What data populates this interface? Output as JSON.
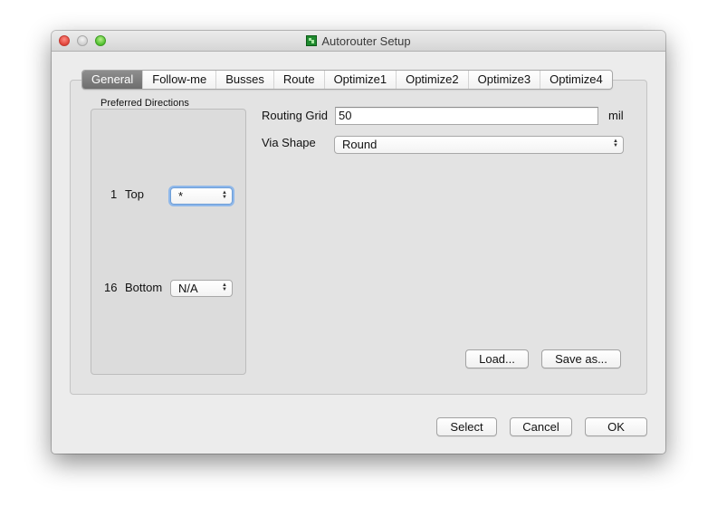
{
  "window": {
    "title": "Autorouter Setup",
    "app_icon": "eagle-app-icon"
  },
  "tabs": [
    {
      "label": "General",
      "active": true
    },
    {
      "label": "Follow-me",
      "active": false
    },
    {
      "label": "Busses",
      "active": false
    },
    {
      "label": "Route",
      "active": false
    },
    {
      "label": "Optimize1",
      "active": false
    },
    {
      "label": "Optimize2",
      "active": false
    },
    {
      "label": "Optimize3",
      "active": false
    },
    {
      "label": "Optimize4",
      "active": false
    }
  ],
  "preferred_directions": {
    "title": "Preferred Directions",
    "layers": [
      {
        "number": "1",
        "name": "Top",
        "value": "*"
      },
      {
        "number": "16",
        "name": "Bottom",
        "value": "N/A"
      }
    ]
  },
  "routing_grid": {
    "label": "Routing Grid",
    "value": "50",
    "unit": "mil"
  },
  "via_shape": {
    "label": "Via Shape",
    "value": "Round"
  },
  "buttons": {
    "load": "Load...",
    "save_as": "Save as...",
    "select": "Select",
    "cancel": "Cancel",
    "ok": "OK"
  }
}
